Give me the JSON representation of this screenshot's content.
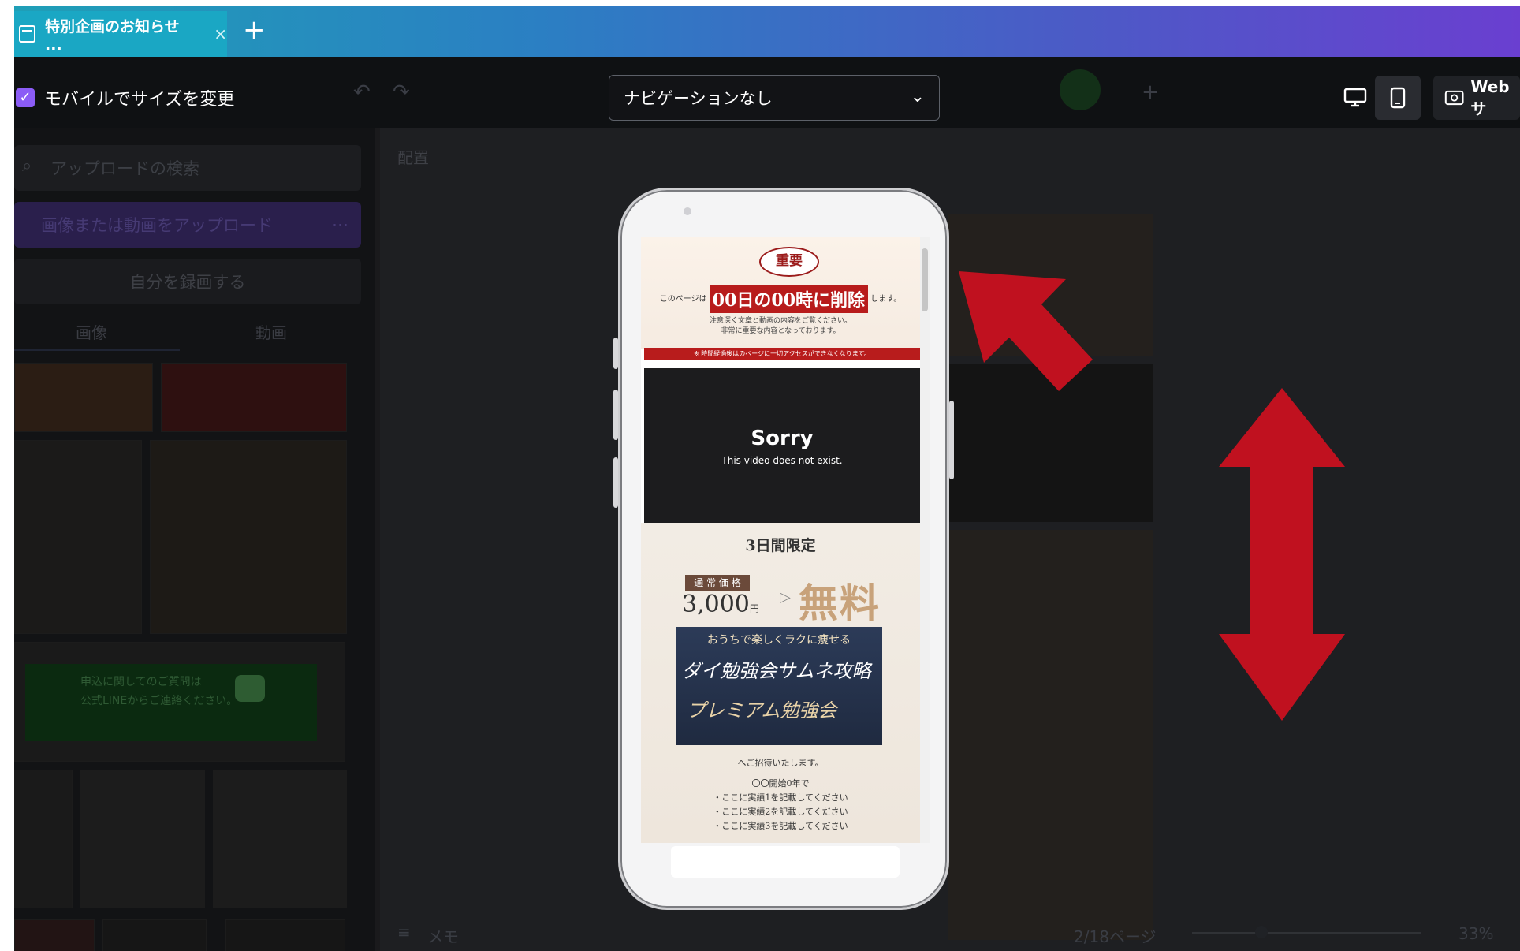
{
  "tab": {
    "title": "特別企画のお知らせ ...",
    "close": "×",
    "new_tab": "+"
  },
  "toolbar": {
    "resize_label": "モバイルでサイズを変更",
    "navigation_select": "ナビゲーションなし",
    "web_label": "Webサ"
  },
  "left_panel": {
    "search_placeholder": "アップロードの検索",
    "upload_button": "画像または動画をアップロード",
    "record_button": "自分を録画する",
    "tabs": [
      "画像",
      "動画"
    ],
    "line_text_1": "申込に関してのご質問は",
    "line_text_2": "公式LINEからご連絡ください。"
  },
  "canvas": {
    "label": "配置",
    "memo": "メモ",
    "page_indicator": "2/18ページ",
    "zoom": "33%"
  },
  "phone": {
    "badge": "重要",
    "delete_prefix": "このページは",
    "delete_text": "00日の00時に削除",
    "delete_suffix": "します。",
    "note_1": "注意深く文章と動画の内容をご覧ください。",
    "note_2": "非常に重要な内容となっております。",
    "red_strip": "※ 時間経過後はのページに一切アクセスができなくなります。",
    "video_title": "Sorry",
    "video_sub": "This video does not exist.",
    "limit": "3日間限定",
    "price_label": "通 常 価 格",
    "price": "3,000",
    "price_unit": "円",
    "free": "無料",
    "banner_top": "おうちで楽しくラクに痩せる",
    "banner_mid": "ダイ勉強会サムネ攻略",
    "banner_bottom": "プレミアム勉強会",
    "invite": "へご招待いたします。",
    "list": [
      "〇〇開始0年で",
      "・ここに実績1を記載してください",
      "・ここに実績2を記載してください",
      "・ここに実績3を記載してください"
    ]
  },
  "colors": {
    "accent_red": "#b81c1c",
    "annotation_red": "#c0111f",
    "check_purple": "#8b5cf6"
  }
}
